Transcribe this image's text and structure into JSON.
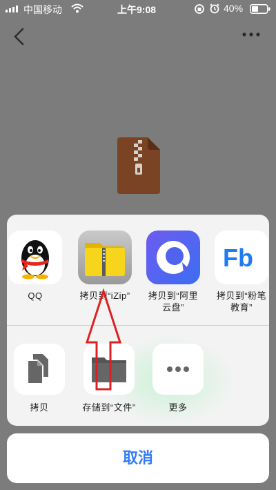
{
  "status_bar": {
    "carrier": "中国移动",
    "time": "上午9:08",
    "battery": "40%"
  },
  "nav": {
    "back_icon": "chevron-left-icon",
    "more_icon": "more-dots-icon"
  },
  "file": {
    "icon": "zip-archive-icon",
    "color": "#7a4324"
  },
  "share_sheet": {
    "apps": [
      {
        "label": "QQ",
        "icon": "qq-penguin-icon"
      },
      {
        "label": "拷贝到“iZip”",
        "icon": "izip-folder-icon"
      },
      {
        "label": "拷贝到“阿里\n云盘”",
        "icon": "aliyun-drive-icon"
      },
      {
        "label": "拷贝到“粉笔\n教育”",
        "icon": "fenbi-icon"
      }
    ],
    "actions": [
      {
        "label": "拷贝",
        "icon": "copy-icon"
      },
      {
        "label": "存储到“文件”",
        "icon": "folder-icon"
      },
      {
        "label": "更多",
        "icon": "more-icon"
      }
    ],
    "cancel": "取消"
  },
  "colors": {
    "dim_background": "#7c7c7c",
    "cancel_text": "#2f7cf6",
    "annotation_arrow": "#e02020"
  }
}
